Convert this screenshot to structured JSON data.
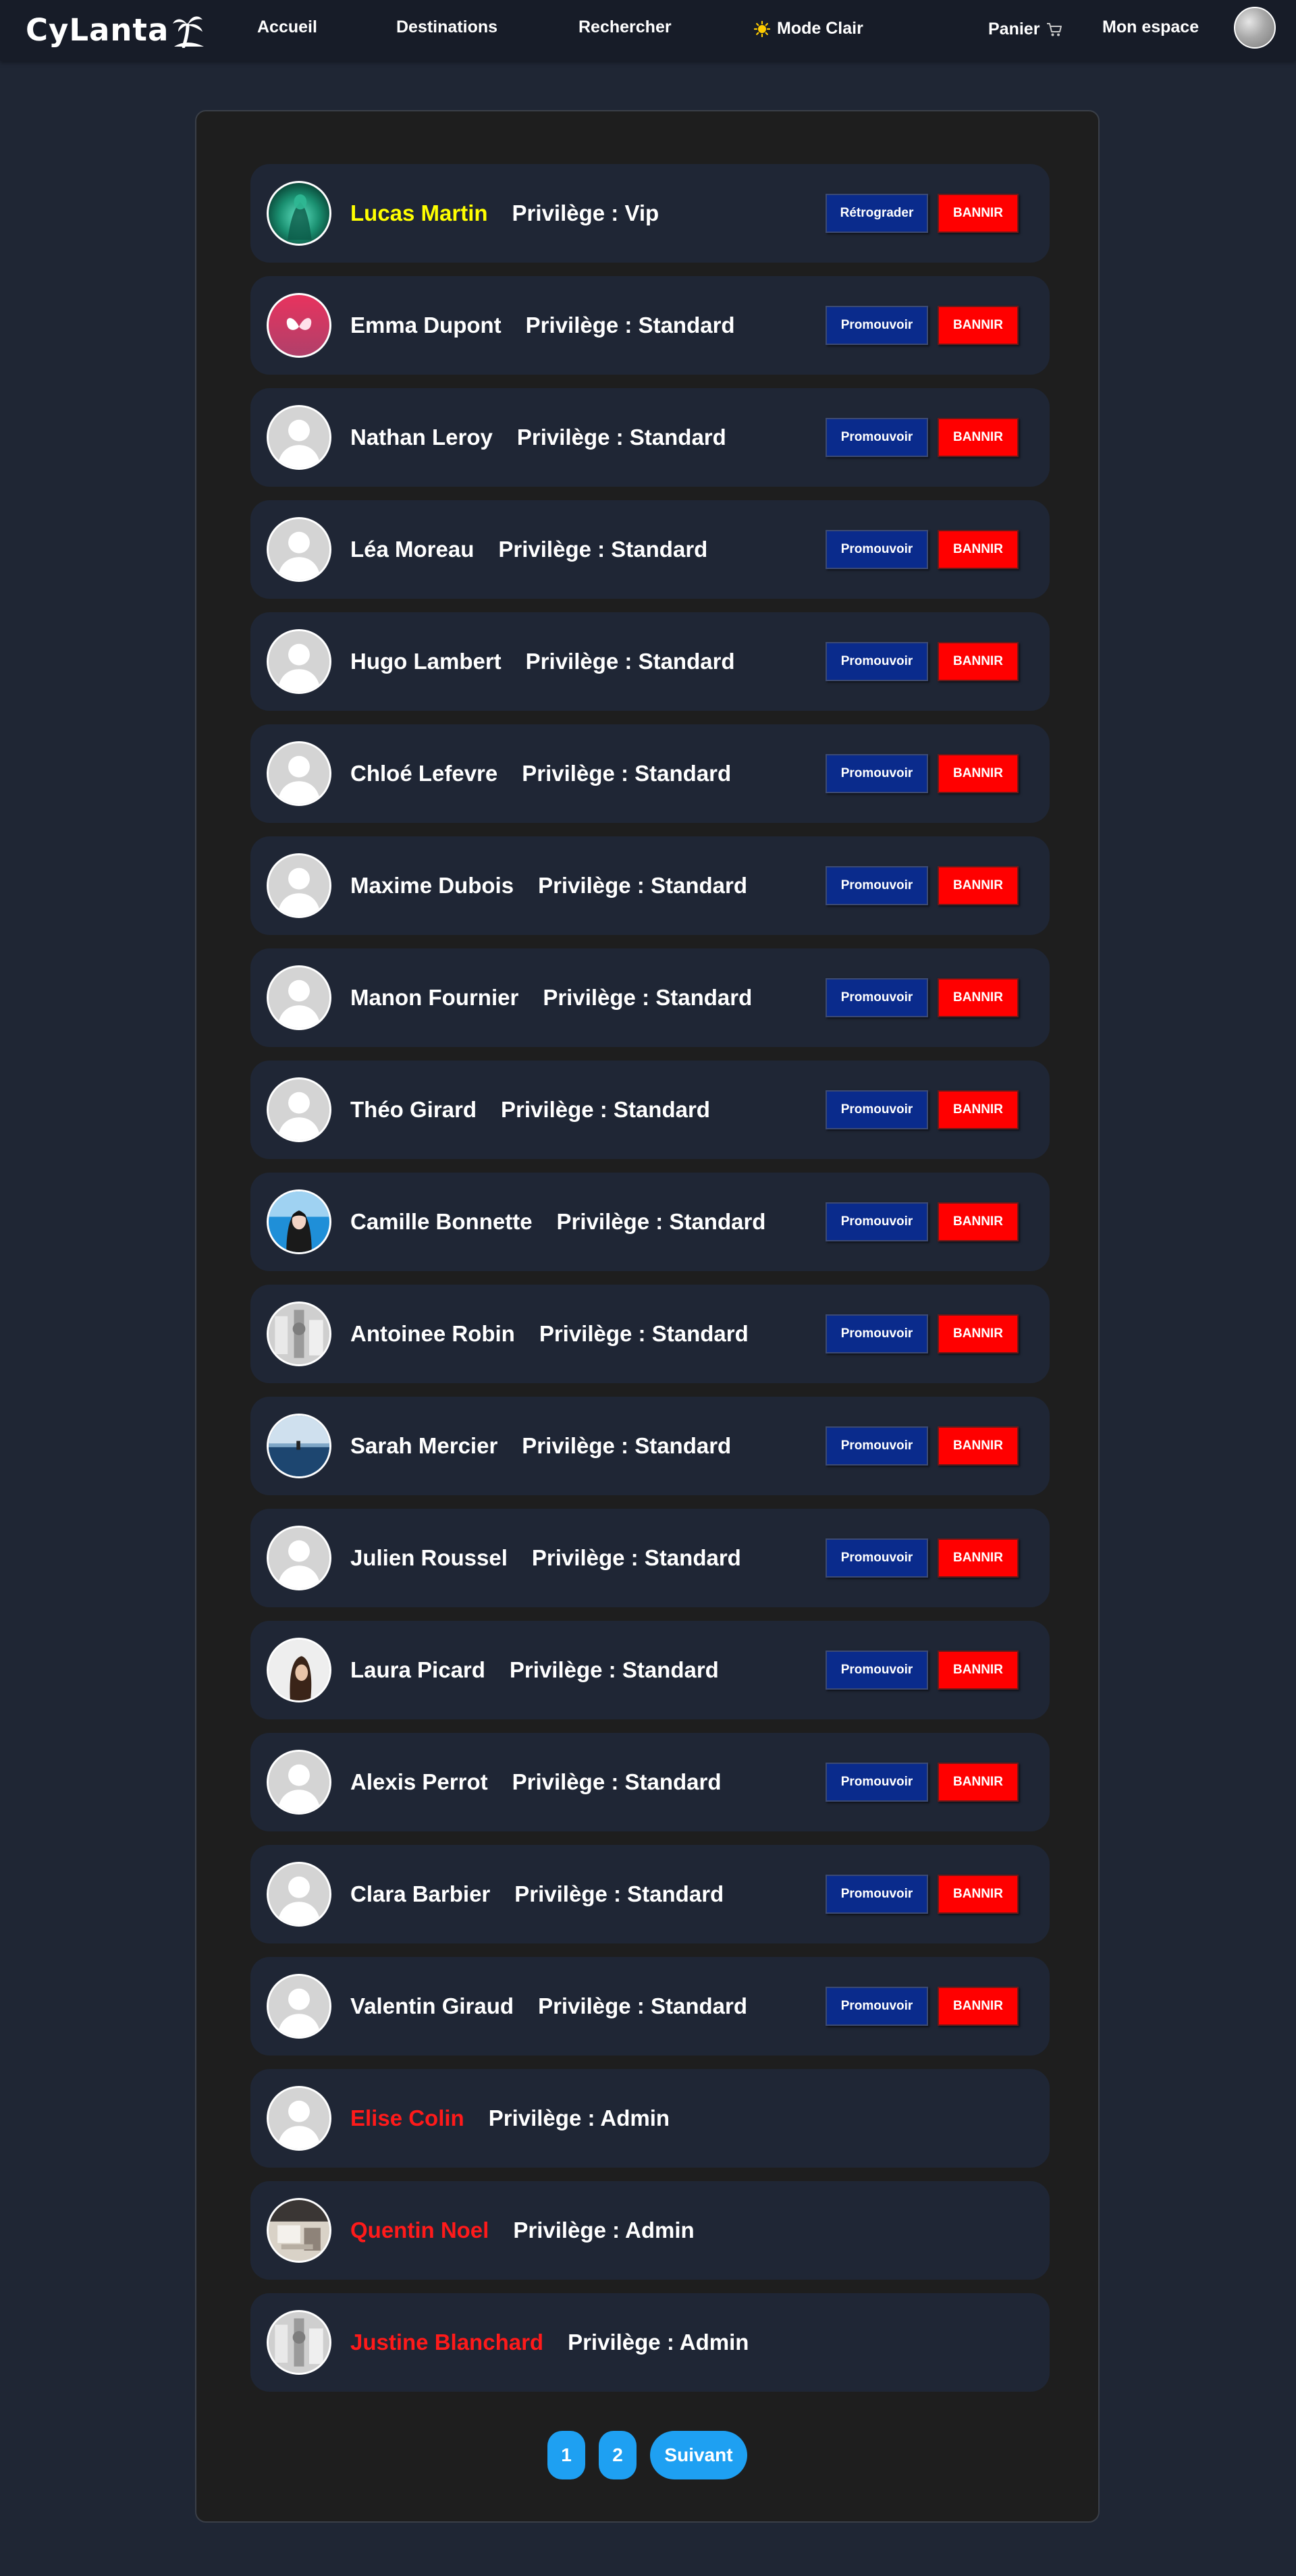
{
  "nav": {
    "brand": "CyLanta",
    "links": [
      {
        "label": "Accueil"
      },
      {
        "label": "Destinations"
      },
      {
        "label": "Rechercher"
      }
    ],
    "theme_label": "Mode Clair",
    "cart_label": "Panier",
    "account_label": "Mon espace"
  },
  "users": [
    {
      "name": "Lucas Martin",
      "privilege": "Privilège : Vip",
      "role": "vip",
      "avatar": "green-photo",
      "promote_label": "Rétrograder",
      "ban_label": "BANNIR"
    },
    {
      "name": "Emma Dupont",
      "privilege": "Privilège : Standard",
      "role": "standard",
      "avatar": "pink-butterfly",
      "promote_label": "Promouvoir",
      "ban_label": "BANNIR"
    },
    {
      "name": "Nathan Leroy",
      "privilege": "Privilège : Standard",
      "role": "standard",
      "avatar": "default",
      "promote_label": "Promouvoir",
      "ban_label": "BANNIR"
    },
    {
      "name": "Léa Moreau",
      "privilege": "Privilège : Standard",
      "role": "standard",
      "avatar": "default",
      "promote_label": "Promouvoir",
      "ban_label": "BANNIR"
    },
    {
      "name": "Hugo Lambert",
      "privilege": "Privilège : Standard",
      "role": "standard",
      "avatar": "default",
      "promote_label": "Promouvoir",
      "ban_label": "BANNIR"
    },
    {
      "name": "Chloé Lefevre",
      "privilege": "Privilège : Standard",
      "role": "standard",
      "avatar": "default",
      "promote_label": "Promouvoir",
      "ban_label": "BANNIR"
    },
    {
      "name": "Maxime Dubois",
      "privilege": "Privilège : Standard",
      "role": "standard",
      "avatar": "default",
      "promote_label": "Promouvoir",
      "ban_label": "BANNIR"
    },
    {
      "name": "Manon Fournier",
      "privilege": "Privilège : Standard",
      "role": "standard",
      "avatar": "default",
      "promote_label": "Promouvoir",
      "ban_label": "BANNIR"
    },
    {
      "name": "Théo Girard",
      "privilege": "Privilège : Standard",
      "role": "standard",
      "avatar": "default",
      "promote_label": "Promouvoir",
      "ban_label": "BANNIR"
    },
    {
      "name": "Camille Bonnette",
      "privilege": "Privilège : Standard",
      "role": "standard",
      "avatar": "portrait-blue",
      "promote_label": "Promouvoir",
      "ban_label": "BANNIR"
    },
    {
      "name": "Antoinee Robin",
      "privilege": "Privilège : Standard",
      "role": "standard",
      "avatar": "gray-photo",
      "promote_label": "Promouvoir",
      "ban_label": "BANNIR"
    },
    {
      "name": "Sarah Mercier",
      "privilege": "Privilège : Standard",
      "role": "standard",
      "avatar": "sea-photo",
      "promote_label": "Promouvoir",
      "ban_label": "BANNIR"
    },
    {
      "name": "Julien Roussel",
      "privilege": "Privilège : Standard",
      "role": "standard",
      "avatar": "default",
      "promote_label": "Promouvoir",
      "ban_label": "BANNIR"
    },
    {
      "name": "Laura Picard",
      "privilege": "Privilège : Standard",
      "role": "standard",
      "avatar": "portrait-light",
      "promote_label": "Promouvoir",
      "ban_label": "BANNIR"
    },
    {
      "name": "Alexis Perrot",
      "privilege": "Privilège : Standard",
      "role": "standard",
      "avatar": "default",
      "promote_label": "Promouvoir",
      "ban_label": "BANNIR"
    },
    {
      "name": "Clara Barbier",
      "privilege": "Privilège : Standard",
      "role": "standard",
      "avatar": "default",
      "promote_label": "Promouvoir",
      "ban_label": "BANNIR"
    },
    {
      "name": "Valentin Giraud",
      "privilege": "Privilège : Standard",
      "role": "standard",
      "avatar": "default",
      "promote_label": "Promouvoir",
      "ban_label": "BANNIR"
    },
    {
      "name": "Elise Colin",
      "privilege": "Privilège : Admin",
      "role": "admin",
      "avatar": "default"
    },
    {
      "name": "Quentin Noel",
      "privilege": "Privilège : Admin",
      "role": "admin",
      "avatar": "room-photo"
    },
    {
      "name": "Justine Blanchard",
      "privilege": "Privilège : Admin",
      "role": "admin",
      "avatar": "gray-photo"
    }
  ],
  "pagination": {
    "pages": [
      "1",
      "2"
    ],
    "next_label": "Suivant"
  },
  "colors": {
    "page_bg": "#1f2634",
    "navbar_bg": "#171c28",
    "panel_bg": "#1e1e1e",
    "card_bg": "#1f2635",
    "vip_name": "#ffff00",
    "admin_name": "#ff1a1a",
    "promote_btn": "#0a2b8c",
    "ban_btn": "#ff0000",
    "pagination_btn": "#1ea0f2"
  }
}
